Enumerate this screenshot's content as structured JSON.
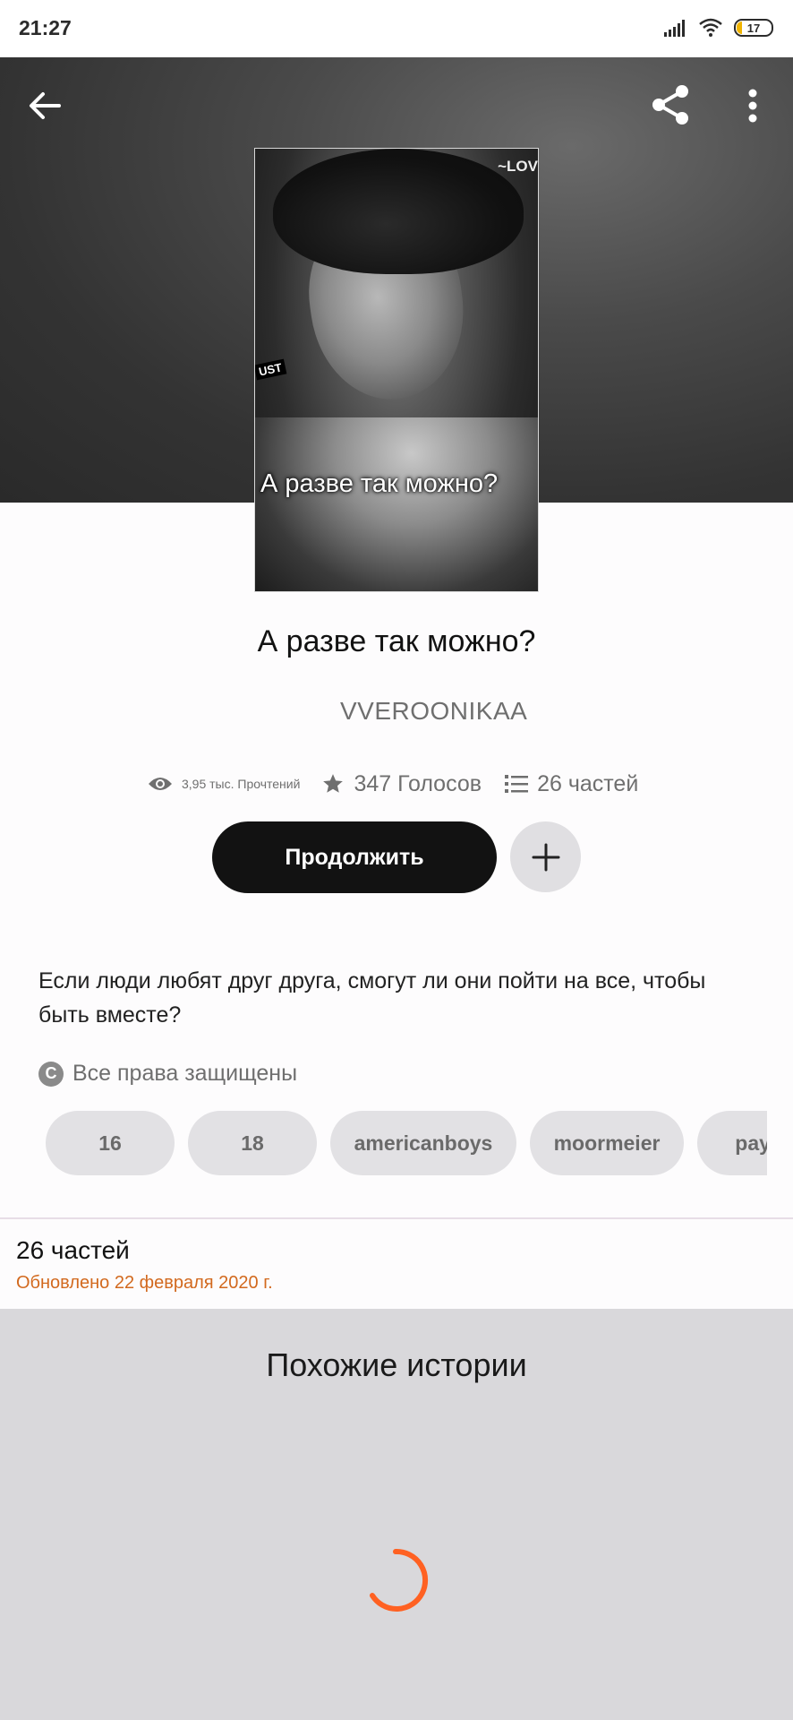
{
  "status_bar": {
    "time": "21:27",
    "battery": "17",
    "icons": [
      "signal-icon",
      "wifi-icon",
      "battery-icon"
    ]
  },
  "header": {
    "icons": [
      "back-arrow-icon",
      "share-icon",
      "more-vertical-icon"
    ]
  },
  "cover": {
    "title_text": "А разве так можно?",
    "tag_top": "~LOV",
    "tag_side": "UST"
  },
  "story": {
    "title": "А разве так можно?",
    "author": "VVEROONIKAA"
  },
  "stats": {
    "reads": "3,95 тыс. Прочтений",
    "votes": "347 Голосов",
    "parts": "26 частей"
  },
  "actions": {
    "continue_label": "Продолжить",
    "add_icon": "plus-icon"
  },
  "description": "Если люди любят друг друга, смогут ли они пойти на все, чтобы быть вместе?",
  "rights": "Все права защищены",
  "tags": [
    "16",
    "18",
    "americanboys",
    "moormeier",
    "payton"
  ],
  "parts_section": {
    "count": "26 частей",
    "updated": "Обновлено 22 февраля 2020 г."
  },
  "similar": {
    "title": "Похожие истории"
  },
  "colors": {
    "accent": "#ff6122",
    "updated_text": "#d2691e",
    "continue_button": "#121212",
    "similar_bg": "#d9d8db"
  }
}
